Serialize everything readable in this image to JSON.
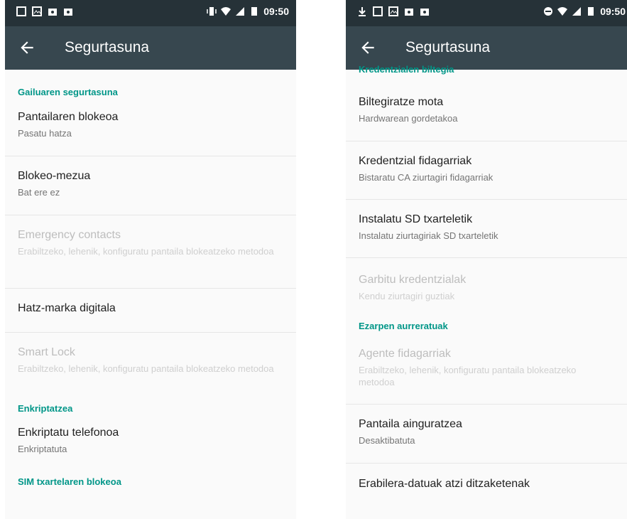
{
  "left": {
    "status": {
      "time": "09:50"
    },
    "title": "Segurtasuna",
    "sections": {
      "device_security": "Gailuaren segurtasuna",
      "encryption": "Enkriptatzea",
      "sim_lock": "SIM txartelaren blokeoa"
    },
    "items": {
      "screen_lock": {
        "title": "Pantailaren blokeoa",
        "summary": "Pasatu hatza"
      },
      "lock_message": {
        "title": "Blokeo-mezua",
        "summary": "Bat ere ez"
      },
      "emergency": {
        "title": "Emergency contacts",
        "summary": "Erabiltzeko, lehenik, konfiguratu pantaila blokeatzeko metodoa"
      },
      "fingerprint": {
        "title": "Hatz-marka digitala"
      },
      "smart_lock": {
        "title": "Smart Lock",
        "summary": "Erabiltzeko, lehenik, konfiguratu pantaila blokeatzeko metodoa"
      },
      "encrypt": {
        "title": "Enkriptatu telefonoa",
        "summary": "Enkriptatuta"
      }
    }
  },
  "right": {
    "status": {
      "time": "09:50"
    },
    "title": "Segurtasuna",
    "sections": {
      "credential_storage": "Kredentzialen biltegia",
      "advanced": "Ezarpen aurreratuak"
    },
    "items": {
      "storage_type": {
        "title": "Biltegiratze mota",
        "summary": "Hardwarean gordetakoa"
      },
      "trusted_creds": {
        "title": "Kredentzial fidagarriak",
        "summary": "Bistaratu CA ziurtagiri fidagarriak"
      },
      "install_sd": {
        "title": "Instalatu SD txarteletik",
        "summary": "Instalatu ziurtagiriak SD txarteletik"
      },
      "clear_creds": {
        "title": "Garbitu kredentzialak",
        "summary": "Kendu ziurtagiri guztiak"
      },
      "trust_agents": {
        "title": "Agente fidagarriak",
        "summary": "Erabiltzeko, lehenik, konfiguratu pantaila blokeatzeko metodoa"
      },
      "screen_pinning": {
        "title": "Pantaila ainguratzea",
        "summary": "Desaktibatuta"
      },
      "usage_access": {
        "title": "Erabilera-datuak atzi ditzaketenak"
      }
    }
  },
  "colors": {
    "accent": "#009688",
    "statusbar": "#263238",
    "appbar": "#37474f"
  }
}
